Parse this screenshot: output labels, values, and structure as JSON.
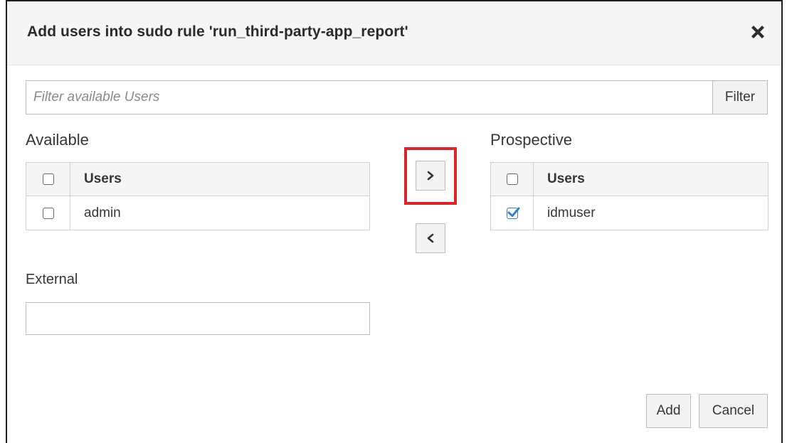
{
  "dialog": {
    "title": "Add users into sudo rule 'run_third-party-app_report'",
    "close_icon": "close-icon"
  },
  "filter": {
    "placeholder": "Filter available Users",
    "value": "",
    "button_label": "Filter"
  },
  "available": {
    "label": "Available",
    "column_header": "Users",
    "header_checked": false,
    "rows": [
      {
        "name": "admin",
        "checked": false
      }
    ]
  },
  "prospective": {
    "label": "Prospective",
    "column_header": "Users",
    "header_checked": false,
    "rows": [
      {
        "name": "idmuser",
        "checked": true
      }
    ]
  },
  "move": {
    "add_icon": "chevron-right-icon",
    "remove_icon": "chevron-left-icon"
  },
  "external": {
    "label": "External",
    "value": ""
  },
  "footer": {
    "add_label": "Add",
    "cancel_label": "Cancel"
  },
  "colors": {
    "highlight": "#d9262b",
    "checkbox_checked": "#3a7ec8"
  }
}
